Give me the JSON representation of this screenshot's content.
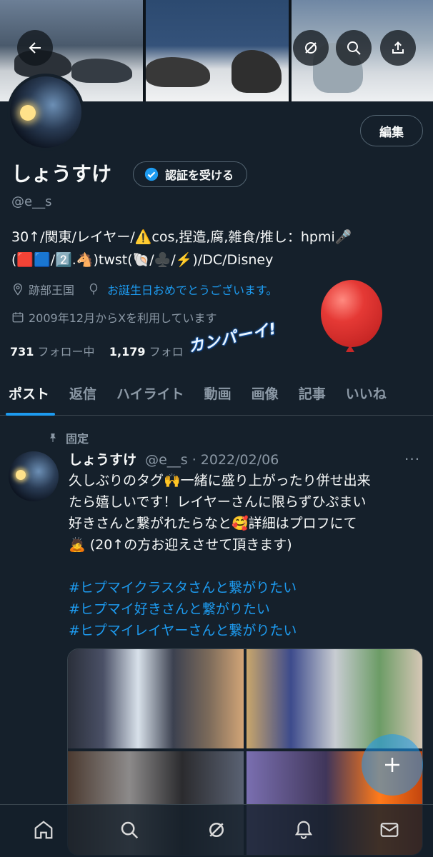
{
  "colors": {
    "background": "#15202b",
    "accent": "#1d9bf0",
    "muted": "#8b98a5",
    "text": "#f7f9f9",
    "border": "#38444d"
  },
  "banner": {
    "icons": [
      "back-arrow-icon",
      "grok-icon",
      "search-icon",
      "share-icon"
    ]
  },
  "profile": {
    "edit_label": "編集",
    "name": "しょうすけ",
    "verify_label": "認証を受ける",
    "handle": "@e__s",
    "bio_line1": "30↑/関東/レイヤー/⚠️cos,捏造,腐,雑食/推し：hpmi🎤",
    "bio_line2": "(🟥🟦/2️⃣.🐴)twst(🐚/♣️/⚡️)/DC/Disney",
    "location": "跡部王国",
    "birthday": "お誕生日おめでとうございます。",
    "joined": "2009年12月からXを利用しています",
    "following_count": "731",
    "following_label": "フォロー中",
    "followers_count": "1,179",
    "followers_label": "フォロ",
    "sticker_text": "カンパーイ!"
  },
  "tabs": [
    {
      "label": "ポスト",
      "active": true
    },
    {
      "label": "返信",
      "active": false
    },
    {
      "label": "ハイライト",
      "active": false
    },
    {
      "label": "動画",
      "active": false
    },
    {
      "label": "画像",
      "active": false
    },
    {
      "label": "記事",
      "active": false
    },
    {
      "label": "いいね",
      "active": false
    }
  ],
  "pinned_post": {
    "pinned_label": "固定",
    "author": "しょうすけ",
    "meta": "@e__s · 2022/02/06",
    "more": "···",
    "body_line1": "久しぶりのタグ🙌一緒に盛り上がったり併せ出来",
    "body_line2": "たら嬉しいです！レイヤーさんに限らずひぷまい",
    "body_line3": "好きさんと繋がれたらなと🥰詳細はプロフにて",
    "body_line4": "🙇 (20↑の方お迎えさせて頂きます)",
    "hashtag1": "#ヒプマイクラスタさんと繋がりたい",
    "hashtag2": "#ヒプマイ好きさんと繋がりたい",
    "hashtag3": "#ヒプマイレイヤーさんと繋がりたい"
  },
  "bottom_nav": [
    "home-icon",
    "explore-search-icon",
    "grok-icon",
    "notifications-icon",
    "messages-icon"
  ]
}
